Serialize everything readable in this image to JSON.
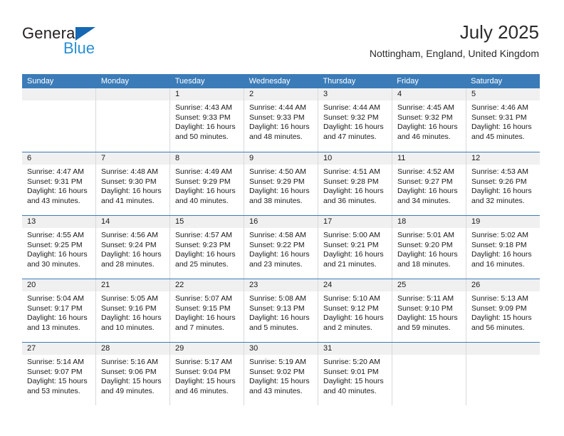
{
  "brand": {
    "name_part1": "General",
    "name_part2": "Blue",
    "triangle_color": "#1668b3",
    "blue_color": "#2a8fd4"
  },
  "header": {
    "title": "July 2025",
    "subtitle": "Nottingham, England, United Kingdom",
    "header_bg": "#3b7cb8",
    "numband_bg": "#f0f0f0"
  },
  "weekday_headers": [
    "Sunday",
    "Monday",
    "Tuesday",
    "Wednesday",
    "Thursday",
    "Friday",
    "Saturday"
  ],
  "weeks": [
    [
      {
        "day": "",
        "lines": []
      },
      {
        "day": "",
        "lines": []
      },
      {
        "day": "1",
        "lines": [
          "Sunrise: 4:43 AM",
          "Sunset: 9:33 PM",
          "Daylight: 16 hours",
          "and 50 minutes."
        ]
      },
      {
        "day": "2",
        "lines": [
          "Sunrise: 4:44 AM",
          "Sunset: 9:33 PM",
          "Daylight: 16 hours",
          "and 48 minutes."
        ]
      },
      {
        "day": "3",
        "lines": [
          "Sunrise: 4:44 AM",
          "Sunset: 9:32 PM",
          "Daylight: 16 hours",
          "and 47 minutes."
        ]
      },
      {
        "day": "4",
        "lines": [
          "Sunrise: 4:45 AM",
          "Sunset: 9:32 PM",
          "Daylight: 16 hours",
          "and 46 minutes."
        ]
      },
      {
        "day": "5",
        "lines": [
          "Sunrise: 4:46 AM",
          "Sunset: 9:31 PM",
          "Daylight: 16 hours",
          "and 45 minutes."
        ]
      }
    ],
    [
      {
        "day": "6",
        "lines": [
          "Sunrise: 4:47 AM",
          "Sunset: 9:31 PM",
          "Daylight: 16 hours",
          "and 43 minutes."
        ]
      },
      {
        "day": "7",
        "lines": [
          "Sunrise: 4:48 AM",
          "Sunset: 9:30 PM",
          "Daylight: 16 hours",
          "and 41 minutes."
        ]
      },
      {
        "day": "8",
        "lines": [
          "Sunrise: 4:49 AM",
          "Sunset: 9:29 PM",
          "Daylight: 16 hours",
          "and 40 minutes."
        ]
      },
      {
        "day": "9",
        "lines": [
          "Sunrise: 4:50 AM",
          "Sunset: 9:29 PM",
          "Daylight: 16 hours",
          "and 38 minutes."
        ]
      },
      {
        "day": "10",
        "lines": [
          "Sunrise: 4:51 AM",
          "Sunset: 9:28 PM",
          "Daylight: 16 hours",
          "and 36 minutes."
        ]
      },
      {
        "day": "11",
        "lines": [
          "Sunrise: 4:52 AM",
          "Sunset: 9:27 PM",
          "Daylight: 16 hours",
          "and 34 minutes."
        ]
      },
      {
        "day": "12",
        "lines": [
          "Sunrise: 4:53 AM",
          "Sunset: 9:26 PM",
          "Daylight: 16 hours",
          "and 32 minutes."
        ]
      }
    ],
    [
      {
        "day": "13",
        "lines": [
          "Sunrise: 4:55 AM",
          "Sunset: 9:25 PM",
          "Daylight: 16 hours",
          "and 30 minutes."
        ]
      },
      {
        "day": "14",
        "lines": [
          "Sunrise: 4:56 AM",
          "Sunset: 9:24 PM",
          "Daylight: 16 hours",
          "and 28 minutes."
        ]
      },
      {
        "day": "15",
        "lines": [
          "Sunrise: 4:57 AM",
          "Sunset: 9:23 PM",
          "Daylight: 16 hours",
          "and 25 minutes."
        ]
      },
      {
        "day": "16",
        "lines": [
          "Sunrise: 4:58 AM",
          "Sunset: 9:22 PM",
          "Daylight: 16 hours",
          "and 23 minutes."
        ]
      },
      {
        "day": "17",
        "lines": [
          "Sunrise: 5:00 AM",
          "Sunset: 9:21 PM",
          "Daylight: 16 hours",
          "and 21 minutes."
        ]
      },
      {
        "day": "18",
        "lines": [
          "Sunrise: 5:01 AM",
          "Sunset: 9:20 PM",
          "Daylight: 16 hours",
          "and 18 minutes."
        ]
      },
      {
        "day": "19",
        "lines": [
          "Sunrise: 5:02 AM",
          "Sunset: 9:18 PM",
          "Daylight: 16 hours",
          "and 16 minutes."
        ]
      }
    ],
    [
      {
        "day": "20",
        "lines": [
          "Sunrise: 5:04 AM",
          "Sunset: 9:17 PM",
          "Daylight: 16 hours",
          "and 13 minutes."
        ]
      },
      {
        "day": "21",
        "lines": [
          "Sunrise: 5:05 AM",
          "Sunset: 9:16 PM",
          "Daylight: 16 hours",
          "and 10 minutes."
        ]
      },
      {
        "day": "22",
        "lines": [
          "Sunrise: 5:07 AM",
          "Sunset: 9:15 PM",
          "Daylight: 16 hours",
          "and 7 minutes."
        ]
      },
      {
        "day": "23",
        "lines": [
          "Sunrise: 5:08 AM",
          "Sunset: 9:13 PM",
          "Daylight: 16 hours",
          "and 5 minutes."
        ]
      },
      {
        "day": "24",
        "lines": [
          "Sunrise: 5:10 AM",
          "Sunset: 9:12 PM",
          "Daylight: 16 hours",
          "and 2 minutes."
        ]
      },
      {
        "day": "25",
        "lines": [
          "Sunrise: 5:11 AM",
          "Sunset: 9:10 PM",
          "Daylight: 15 hours",
          "and 59 minutes."
        ]
      },
      {
        "day": "26",
        "lines": [
          "Sunrise: 5:13 AM",
          "Sunset: 9:09 PM",
          "Daylight: 15 hours",
          "and 56 minutes."
        ]
      }
    ],
    [
      {
        "day": "27",
        "lines": [
          "Sunrise: 5:14 AM",
          "Sunset: 9:07 PM",
          "Daylight: 15 hours",
          "and 53 minutes."
        ]
      },
      {
        "day": "28",
        "lines": [
          "Sunrise: 5:16 AM",
          "Sunset: 9:06 PM",
          "Daylight: 15 hours",
          "and 49 minutes."
        ]
      },
      {
        "day": "29",
        "lines": [
          "Sunrise: 5:17 AM",
          "Sunset: 9:04 PM",
          "Daylight: 15 hours",
          "and 46 minutes."
        ]
      },
      {
        "day": "30",
        "lines": [
          "Sunrise: 5:19 AM",
          "Sunset: 9:02 PM",
          "Daylight: 15 hours",
          "and 43 minutes."
        ]
      },
      {
        "day": "31",
        "lines": [
          "Sunrise: 5:20 AM",
          "Sunset: 9:01 PM",
          "Daylight: 15 hours",
          "and 40 minutes."
        ]
      },
      {
        "day": "",
        "lines": []
      },
      {
        "day": "",
        "lines": []
      }
    ]
  ]
}
